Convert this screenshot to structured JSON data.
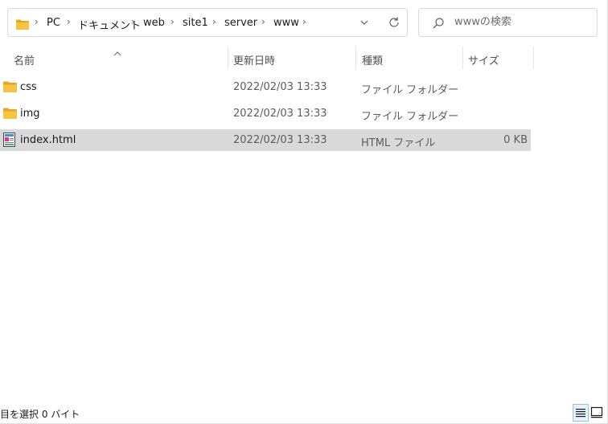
{
  "address_bar": {
    "breadcrumbs": [
      "PC",
      "ドキュメント",
      "web",
      "site1",
      "server",
      "www"
    ]
  },
  "search": {
    "placeholder": "wwwの検索"
  },
  "columns": {
    "name": "名前",
    "date": "更新日時",
    "type": "種類",
    "size": "サイズ"
  },
  "files": [
    {
      "name": "css",
      "date": "2022/02/03 13:33",
      "type": "ファイル フォルダー",
      "size": "",
      "icon": "folder-icon",
      "selected": false
    },
    {
      "name": "img",
      "date": "2022/02/03 13:33",
      "type": "ファイル フォルダー",
      "size": "",
      "icon": "folder-icon",
      "selected": false
    },
    {
      "name": "index.html",
      "date": "2022/02/03 13:33",
      "type": "HTML ファイル",
      "size": "0 KB",
      "icon": "html-file-icon",
      "selected": true
    }
  ],
  "status_bar": {
    "text": "目を選択  0 バイト"
  },
  "colors": {
    "folder": "#f8c342",
    "selected_row": "#d9d9d9",
    "accent": "#0067c0"
  }
}
